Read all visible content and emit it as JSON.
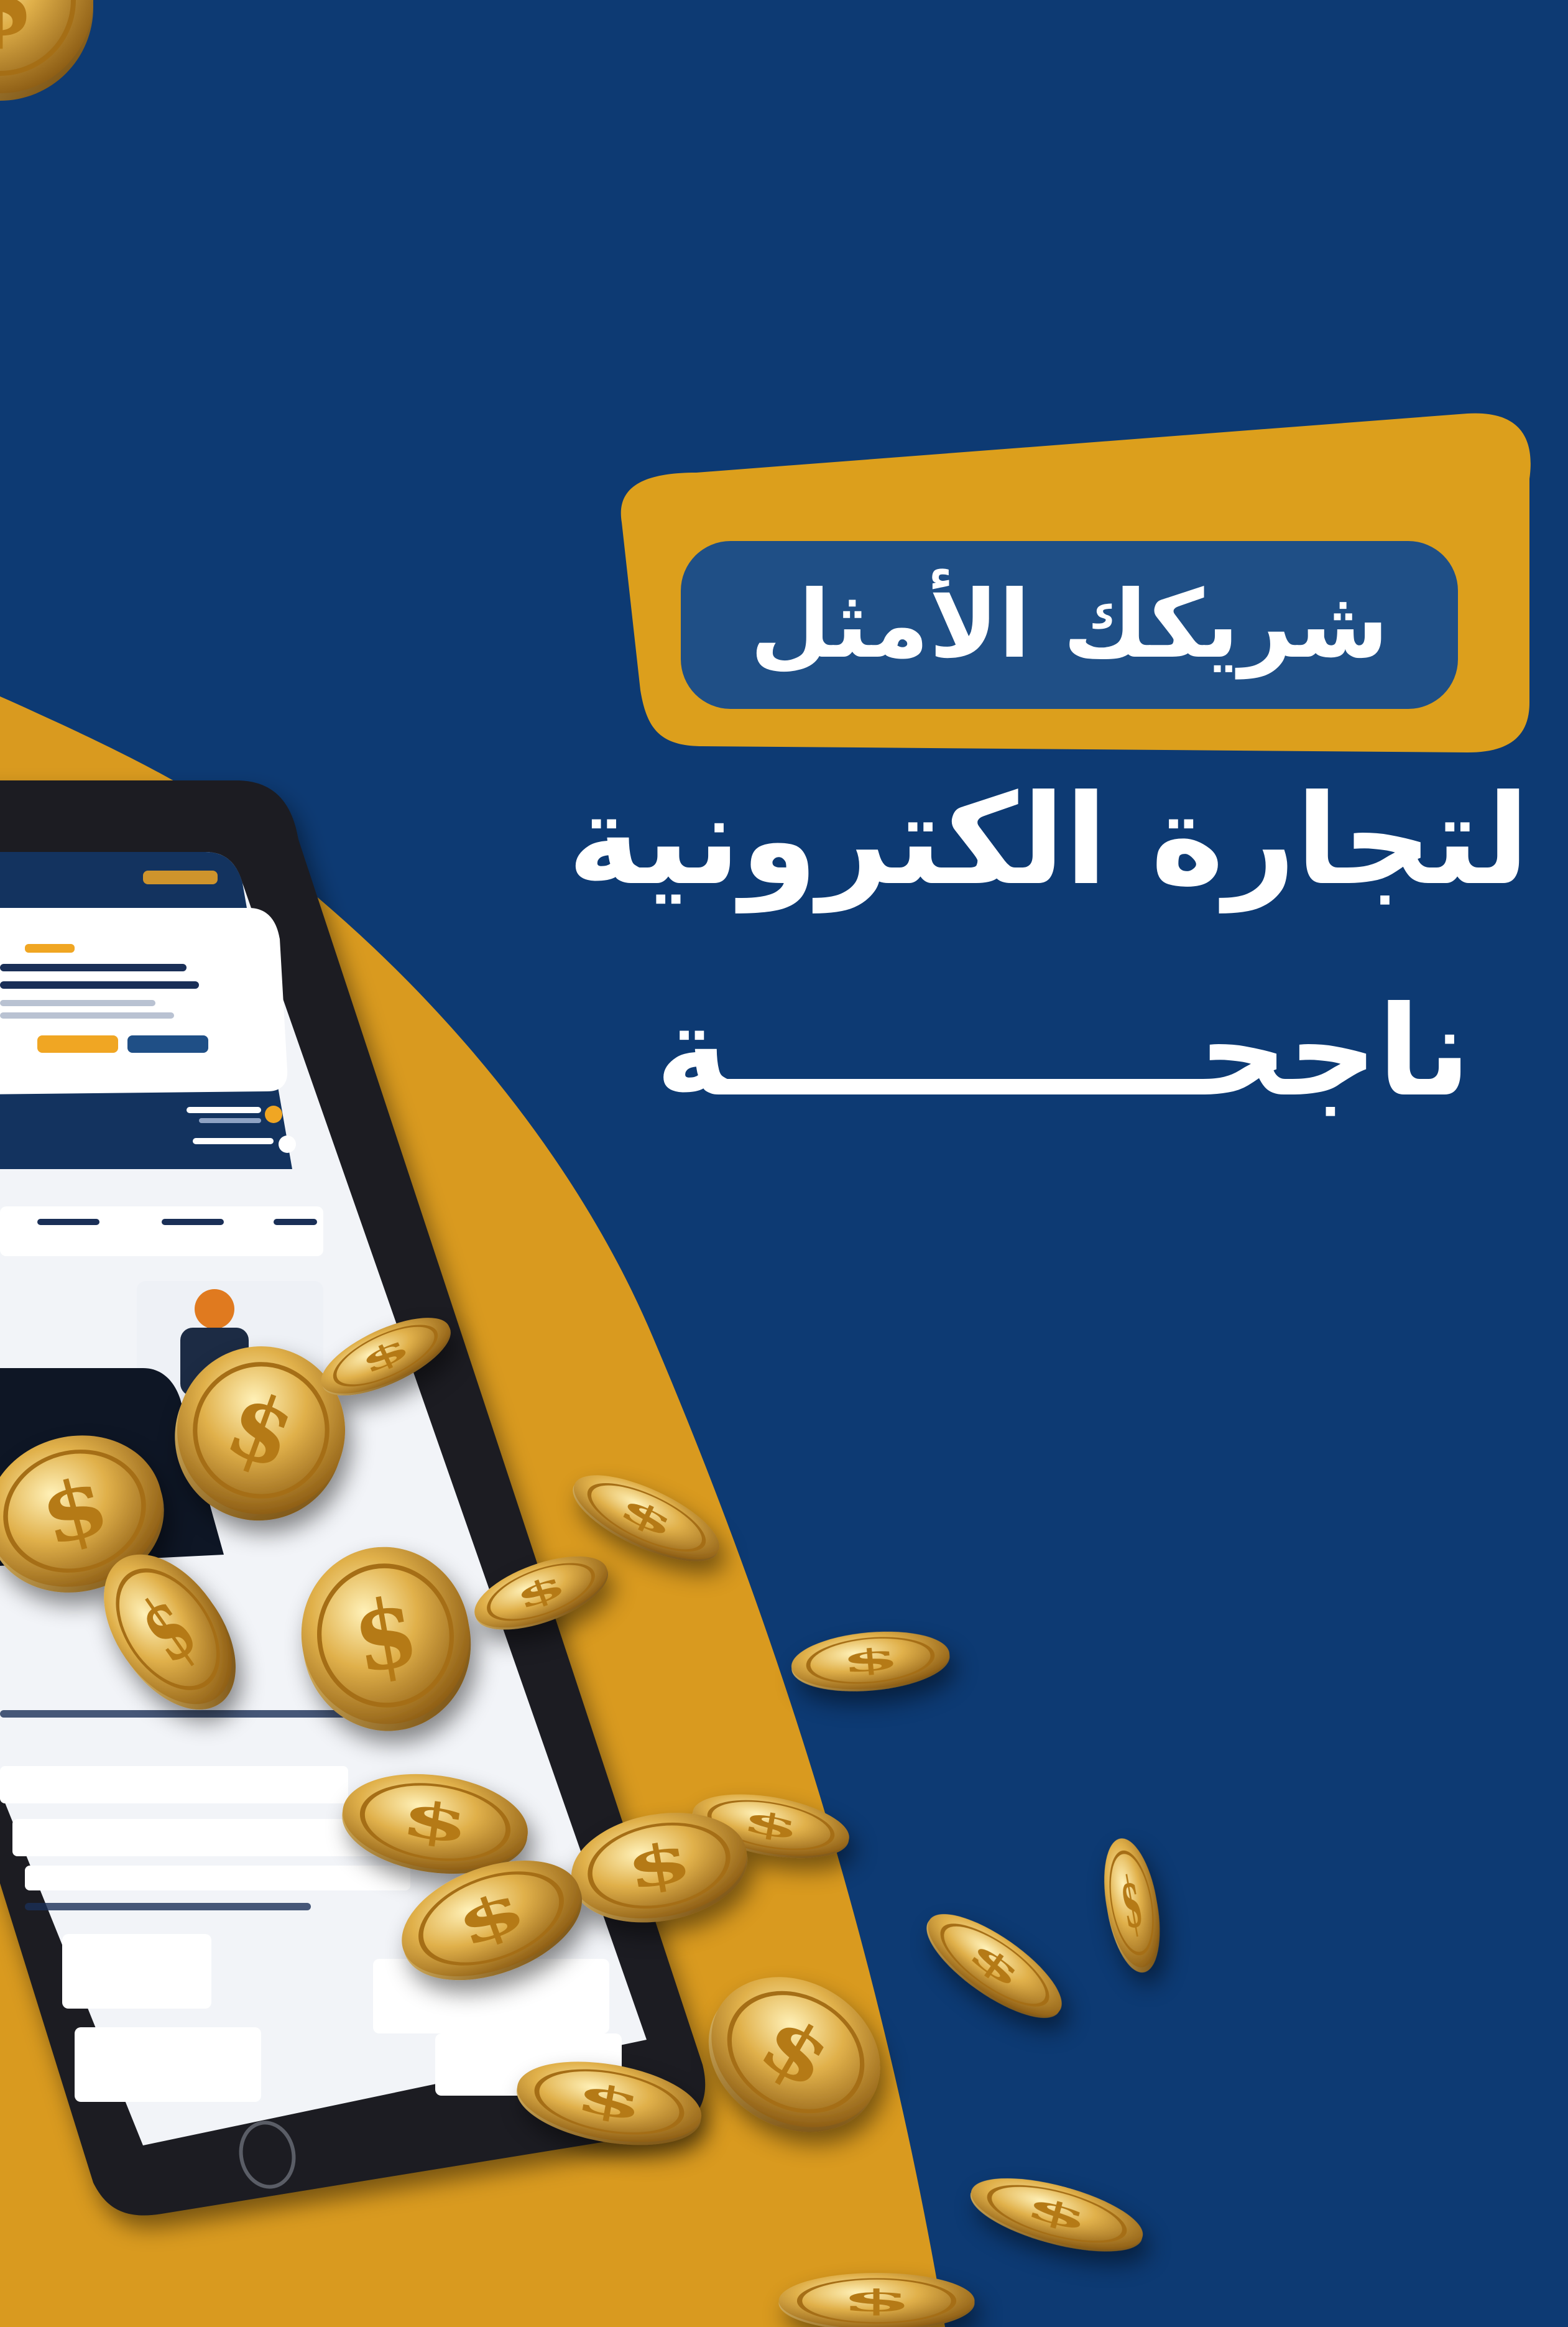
{
  "headline": {
    "pill_text": "شريكك الأمثل",
    "line2": "لتجارة الكترونية",
    "line3": "ناجحـــــــــــة"
  },
  "colors": {
    "background": "#0d3a73",
    "gold": "#d99a1f",
    "pill": "#1f4f86",
    "white": "#ffffff"
  },
  "icons": [
    "tablet-device",
    "gold-dollar-coin",
    "home-button"
  ]
}
